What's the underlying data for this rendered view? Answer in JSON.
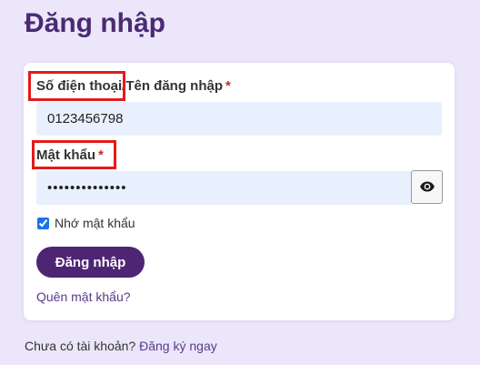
{
  "page": {
    "title": "Đăng nhập"
  },
  "form": {
    "username": {
      "label": "Số điện thoại/Tên đăng nhập",
      "required_mark": "*",
      "value": "0123456798"
    },
    "password": {
      "label": "Mật khẩu",
      "required_mark": "*",
      "value": "**************",
      "toggle_icon": "eye-icon"
    },
    "remember": {
      "label": "Nhớ mật khẩu",
      "checked": true
    },
    "submit_label": "Đăng nhập",
    "forgot_link": "Quên mật khẩu?"
  },
  "footer": {
    "no_account_text": "Chưa có tài khoản?",
    "register_link": "Đăng ký ngay"
  },
  "colors": {
    "background": "#ebe6fa",
    "brand": "#4d2574",
    "title": "#4b2a73",
    "required": "#c62828",
    "highlight": "#e21b1b",
    "input_fill": "#e8f0fe"
  }
}
